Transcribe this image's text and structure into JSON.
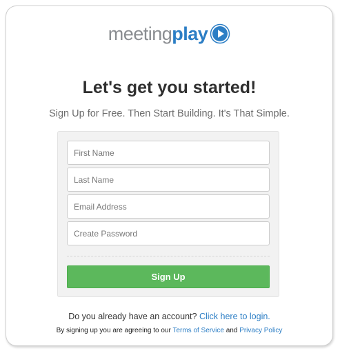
{
  "brand": {
    "word1": "meeting",
    "word2": "play",
    "primary_color": "#2c7ec5",
    "secondary_color": "#8a8d91"
  },
  "headline": "Let's get you started!",
  "subheadline": "Sign Up for Free. Then Start Building. It's That Simple.",
  "form": {
    "first_name_placeholder": "First Name",
    "first_name_value": "",
    "last_name_placeholder": "Last Name",
    "last_name_value": "",
    "email_placeholder": "Email Address",
    "email_value": "",
    "password_placeholder": "Create Password",
    "password_value": "",
    "submit_label": "Sign Up",
    "submit_color": "#5cb85c"
  },
  "login_prompt": {
    "text": "Do you already have an account?",
    "link_label": "Click here to login."
  },
  "terms": {
    "prefix": "By signing up you are agreeing to our",
    "terms_link": "Terms of Service",
    "conjunction": "and",
    "privacy_link": "Privacy Policy"
  },
  "icons": {
    "logo_play": "play-circle-icon"
  }
}
